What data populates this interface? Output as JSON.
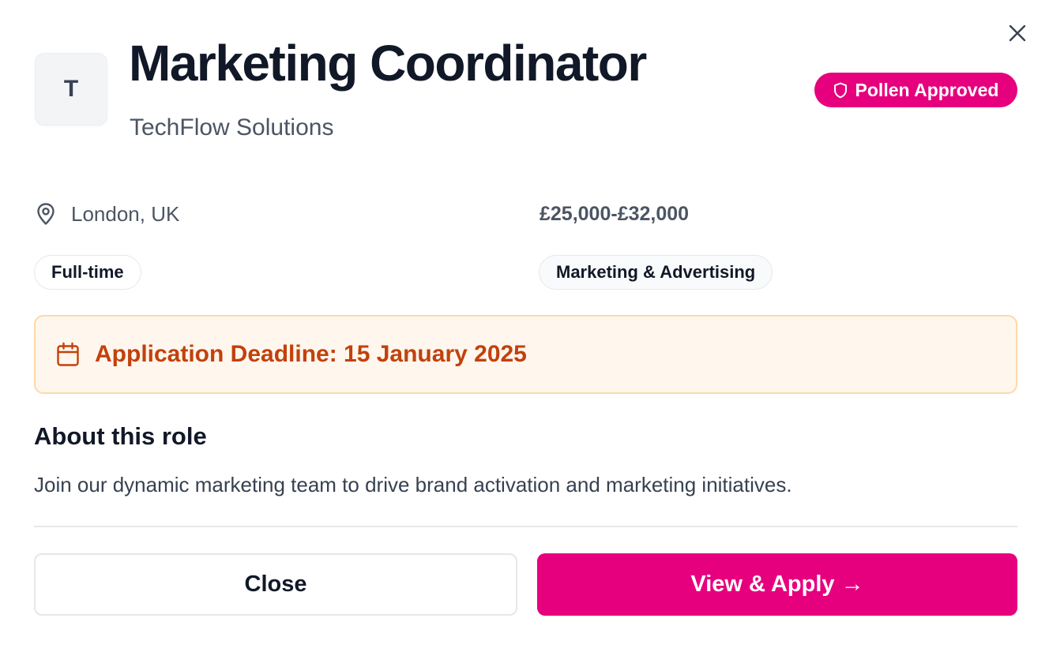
{
  "job": {
    "logo_letter": "T",
    "title": "Marketing Coordinator",
    "company": "TechFlow Solutions",
    "badge_label": "Pollen Approved",
    "location": "London, UK",
    "salary": "£25,000-£32,000",
    "employment_type": "Full-time",
    "category": "Marketing & Advertising",
    "deadline_text": "Application Deadline: 15 January 2025"
  },
  "about": {
    "heading": "About this role",
    "description": "Join our dynamic marketing team to drive brand activation and marketing initiatives."
  },
  "actions": {
    "close_label": "Close",
    "apply_label": "View & Apply →"
  },
  "icons": {
    "close": "close-icon",
    "badge": "shield-icon",
    "location": "map-pin-icon",
    "deadline": "calendar-icon"
  },
  "colors": {
    "brand": "#e6007e",
    "deadline_text": "#c2410c",
    "deadline_bg": "#fff6ed",
    "deadline_border": "#fcd9ad"
  }
}
